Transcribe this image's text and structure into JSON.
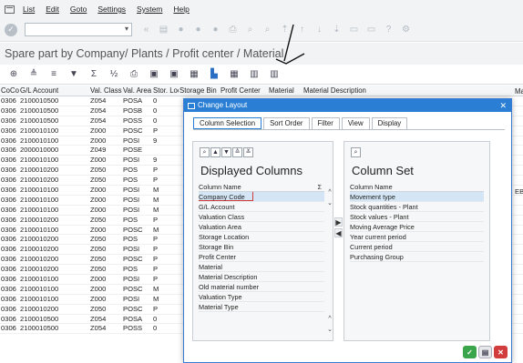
{
  "menubar": {
    "items": [
      "List",
      "Edit",
      "Goto",
      "Settings",
      "System",
      "Help"
    ]
  },
  "toolbar1": {
    "command_value": ""
  },
  "title": "Spare part by Company/ Plants / Profit center / Material",
  "grid": {
    "headers": [
      "CoCode",
      "G/L Account",
      "Val. Class",
      "Val. Area",
      "Stor. Loc.",
      "Storage Bin",
      "Profit Center",
      "Material",
      "Material Description"
    ],
    "header_tail": "Ma",
    "rows": [
      [
        "0306",
        "2100010500",
        "Z054",
        "POSA",
        "0"
      ],
      [
        "0306",
        "2100010500",
        "Z054",
        "POSB",
        "0"
      ],
      [
        "0306",
        "2100010500",
        "Z054",
        "POSS",
        "0"
      ],
      [
        "0306",
        "2100010100",
        "Z000",
        "POSC",
        "P"
      ],
      [
        "0306",
        "2100010100",
        "Z000",
        "POSI",
        "9"
      ],
      [
        "0306",
        "2000010000",
        "Z049",
        "POSE",
        ""
      ],
      [
        "0306",
        "2100010100",
        "Z000",
        "POSI",
        "9"
      ],
      [
        "0306",
        "2100010200",
        "Z050",
        "POS",
        "P"
      ],
      [
        "0306",
        "2100010200",
        "Z050",
        "POS",
        "P"
      ],
      [
        "0306",
        "2100010100",
        "Z000",
        "POSI",
        "M"
      ],
      [
        "0306",
        "2100010100",
        "Z000",
        "POSI",
        "M"
      ],
      [
        "0306",
        "2100010100",
        "Z000",
        "POSI",
        "M"
      ],
      [
        "0306",
        "2100010200",
        "Z050",
        "POS",
        "P"
      ],
      [
        "0306",
        "2100010100",
        "Z000",
        "POSC",
        "M"
      ],
      [
        "0306",
        "2100010200",
        "Z050",
        "POS",
        "P"
      ],
      [
        "0306",
        "2100010200",
        "Z050",
        "POSI",
        "P"
      ],
      [
        "0306",
        "2100010200",
        "Z050",
        "POSC",
        "P"
      ],
      [
        "0306",
        "2100010200",
        "Z050",
        "POS",
        "P"
      ],
      [
        "0306",
        "2100010100",
        "Z000",
        "POSI",
        "P"
      ],
      [
        "0306",
        "2100010100",
        "Z000",
        "POSC",
        "M"
      ],
      [
        "0306",
        "2100010100",
        "Z000",
        "POSI",
        "M"
      ],
      [
        "0306",
        "2100010200",
        "Z050",
        "POSC",
        "P"
      ],
      [
        "0306",
        "2100010500",
        "Z054",
        "POSA",
        "0"
      ],
      [
        "0306",
        "2100010500",
        "Z054",
        "POSS",
        "0"
      ]
    ],
    "eb_tail": "EB"
  },
  "dialog": {
    "title": "Change Layout",
    "tabs": [
      "Column Selection",
      "Sort Order",
      "Filter",
      "View",
      "Display"
    ],
    "left": {
      "heading": "Displayed Columns",
      "col_header": "Column Name",
      "sum_header": "Σ",
      "items": [
        "Company Code",
        "G/L Account",
        "Valuation Class",
        "Valuation Area",
        "Storage Location",
        "Storage Bin",
        "Profit Center",
        "Material",
        "Material Description",
        "Old material number",
        "Valuation Type",
        "Material Type"
      ]
    },
    "right": {
      "heading": "Column Set",
      "col_header": "Column Name",
      "items": [
        "Movement type",
        "Stock quantities - Plant",
        "Stock values - Plant",
        "Moving Average Price",
        "Year current period",
        "Current period",
        "Purchasing Group"
      ]
    }
  }
}
